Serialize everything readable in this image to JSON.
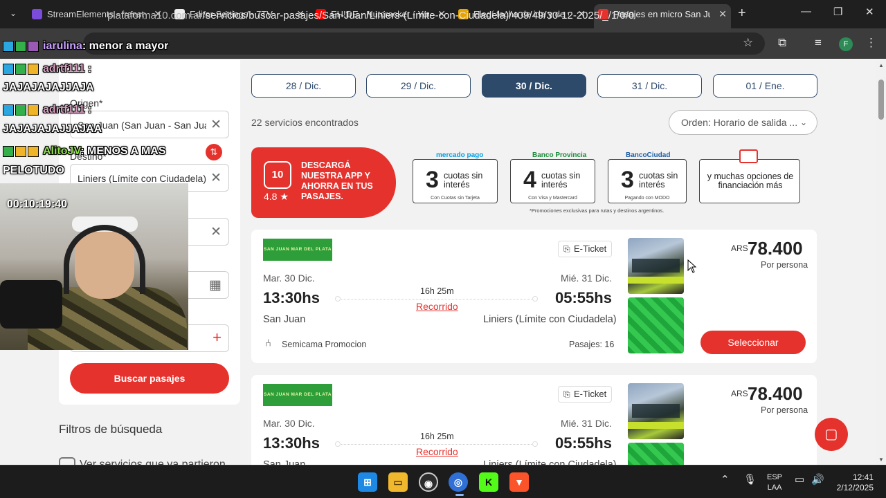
{
  "browser": {
    "tabs": [
      {
        "title": "StreamElements - fransty",
        "fav_color": "#7b4bdb"
      },
      {
        "title": "Editor Settings - 7TV",
        "fav_color": "#ffffff"
      },
      {
        "title": "EH!DE - Nutcracker - You",
        "fav_color": "#ff0000"
      },
      {
        "title": "Elegí fecha de ida y de vu",
        "fav_color": "#e8a400"
      },
      {
        "title": "Pasajes en micro San Juan",
        "fav_color": "#e5322d"
      }
    ],
    "url_prefix": "plataforma10.com.ar",
    "url_path": "/servicios/buscar-pasajes/San-Juan/Liniers-(Límite-con-Ciudadela)/409/49/30-12-2025/_/1/0/0",
    "profile_initial": "F"
  },
  "search": {
    "origin_label": "Origen*",
    "origin_value": "San Juan (San Juan - San Jua",
    "dest_label": "Destino*",
    "dest_value": "Liniers (Límite con Ciudadela)",
    "button_label": "Buscar pasajes",
    "filters_title": "Filtros de búsqueda",
    "filter_option": "Ver servicios que ya partieron"
  },
  "dates": [
    {
      "label": "28 / Dic.",
      "active": false
    },
    {
      "label": "29 / Dic.",
      "active": false
    },
    {
      "label": "30 / Dic.",
      "active": true
    },
    {
      "label": "31 / Dic.",
      "active": false
    },
    {
      "label": "01 / Ene.",
      "active": false
    }
  ],
  "results": {
    "count_text": "22 servicios encontrados",
    "sort_label": "Orden: Horario de salida ..."
  },
  "banner": {
    "app_logo": "10",
    "rating": "4.8 ★",
    "app_text": "DESCARGÁ NUESTRA APP Y AHORRA EN TUS PASAJES.",
    "promos": [
      {
        "brand": "mercado pago",
        "brand_color": "#00a0e3",
        "big": "3",
        "small": "cuotas sin interés",
        "foot": "Con Cuotas sin Tarjeta"
      },
      {
        "brand": "Banco Provincia",
        "brand_color": "#1b8a3b",
        "big": "4",
        "small": "cuotas sin interés",
        "foot": "Con Visa y Mastercard"
      },
      {
        "brand": "BancoCiudad",
        "brand_color": "#1f5fa8",
        "big": "3",
        "small": "cuotas sin interés",
        "foot": "Pagando con MODO"
      },
      {
        "brand": "",
        "brand_color": "#e5322d",
        "big": "",
        "small": "y muchas opciones de financiación más",
        "foot": ""
      }
    ],
    "note": "*Promociones exclusivas para rutas y destinos argentinos."
  },
  "cards": [
    {
      "company": "SAN JUAN MAR DEL PLATA",
      "ticket_type": "E-Ticket",
      "dep_date": "Mar. 30 Dic.",
      "arr_date": "Mié. 31 Dic.",
      "dep_time": "13:30hs",
      "arr_time": "05:55hs",
      "duration": "16h 25m",
      "route_link": "Recorrido",
      "origin": "San Juan",
      "destination": "Liniers (Límite con Ciudadela)",
      "seat_type": "Semicama Promocion",
      "seats": "Pasajes: 16",
      "currency": "ARS",
      "price": "78.400",
      "price_note": "Por persona",
      "cta": "Seleccionar"
    },
    {
      "company": "SAN JUAN MAR DEL PLATA",
      "ticket_type": "E-Ticket",
      "dep_date": "Mar. 30 Dic.",
      "arr_date": "Mié. 31 Dic.",
      "dep_time": "13:30hs",
      "arr_time": "05:55hs",
      "duration": "16h 25m",
      "route_link": "Recorrido",
      "origin": "San Juan",
      "destination": "Liniers (Límite con Ciudadela)",
      "seat_type": "",
      "seats": "",
      "currency": "ARS",
      "price": "78.400",
      "price_note": "Por persona",
      "cta": "Seleccionar"
    }
  ],
  "overlay": {
    "chat": [
      {
        "user": "iarulina",
        "user_color": "#c9a0ff",
        "msg": ": menor a mayor"
      },
      {
        "user": "adrtf111",
        "user_color": "#d6a0c0",
        "msg": " :"
      },
      {
        "user": "",
        "user_color": "#ffffff",
        "msg": "JAJAJAJAJJAJA"
      },
      {
        "user": "adrtf111",
        "user_color": "#d6a0c0",
        "msg": " :"
      },
      {
        "user": "",
        "user_color": "#ffffff",
        "msg": "JAJAJAJAJJAJAA"
      },
      {
        "user": "AlitoJV",
        "user_color": "#8ee04a",
        "msg": ": MENOS A MAS"
      },
      {
        "user": "",
        "user_color": "#ffffff",
        "msg": "PELOTUDO"
      }
    ],
    "timer": "00:10:19:40"
  },
  "taskbar": {
    "lang_top": "ESP",
    "lang_bottom": "LAA",
    "time": "12:41",
    "date": "2/12/2025"
  }
}
